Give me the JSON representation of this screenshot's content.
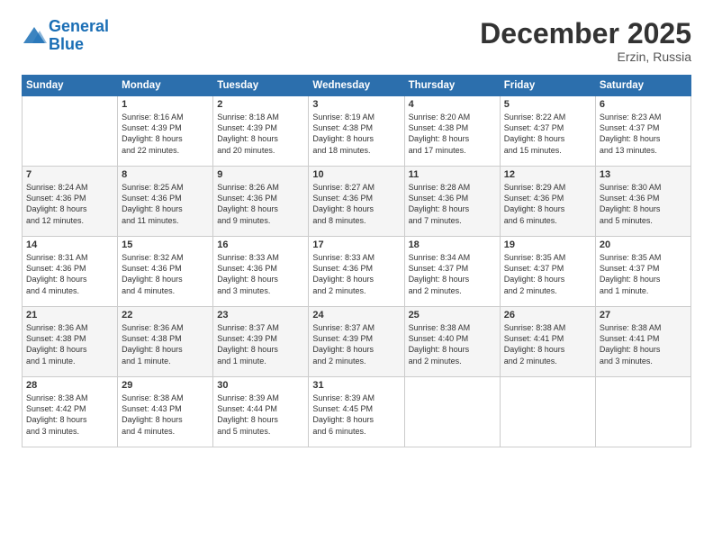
{
  "logo": {
    "line1": "General",
    "line2": "Blue"
  },
  "header": {
    "month": "December 2025",
    "location": "Erzin, Russia"
  },
  "weekdays": [
    "Sunday",
    "Monday",
    "Tuesday",
    "Wednesday",
    "Thursday",
    "Friday",
    "Saturday"
  ],
  "weeks": [
    [
      {
        "day": "",
        "info": ""
      },
      {
        "day": "1",
        "info": "Sunrise: 8:16 AM\nSunset: 4:39 PM\nDaylight: 8 hours\nand 22 minutes."
      },
      {
        "day": "2",
        "info": "Sunrise: 8:18 AM\nSunset: 4:39 PM\nDaylight: 8 hours\nand 20 minutes."
      },
      {
        "day": "3",
        "info": "Sunrise: 8:19 AM\nSunset: 4:38 PM\nDaylight: 8 hours\nand 18 minutes."
      },
      {
        "day": "4",
        "info": "Sunrise: 8:20 AM\nSunset: 4:38 PM\nDaylight: 8 hours\nand 17 minutes."
      },
      {
        "day": "5",
        "info": "Sunrise: 8:22 AM\nSunset: 4:37 PM\nDaylight: 8 hours\nand 15 minutes."
      },
      {
        "day": "6",
        "info": "Sunrise: 8:23 AM\nSunset: 4:37 PM\nDaylight: 8 hours\nand 13 minutes."
      }
    ],
    [
      {
        "day": "7",
        "info": "Sunrise: 8:24 AM\nSunset: 4:36 PM\nDaylight: 8 hours\nand 12 minutes."
      },
      {
        "day": "8",
        "info": "Sunrise: 8:25 AM\nSunset: 4:36 PM\nDaylight: 8 hours\nand 11 minutes."
      },
      {
        "day": "9",
        "info": "Sunrise: 8:26 AM\nSunset: 4:36 PM\nDaylight: 8 hours\nand 9 minutes."
      },
      {
        "day": "10",
        "info": "Sunrise: 8:27 AM\nSunset: 4:36 PM\nDaylight: 8 hours\nand 8 minutes."
      },
      {
        "day": "11",
        "info": "Sunrise: 8:28 AM\nSunset: 4:36 PM\nDaylight: 8 hours\nand 7 minutes."
      },
      {
        "day": "12",
        "info": "Sunrise: 8:29 AM\nSunset: 4:36 PM\nDaylight: 8 hours\nand 6 minutes."
      },
      {
        "day": "13",
        "info": "Sunrise: 8:30 AM\nSunset: 4:36 PM\nDaylight: 8 hours\nand 5 minutes."
      }
    ],
    [
      {
        "day": "14",
        "info": "Sunrise: 8:31 AM\nSunset: 4:36 PM\nDaylight: 8 hours\nand 4 minutes."
      },
      {
        "day": "15",
        "info": "Sunrise: 8:32 AM\nSunset: 4:36 PM\nDaylight: 8 hours\nand 4 minutes."
      },
      {
        "day": "16",
        "info": "Sunrise: 8:33 AM\nSunset: 4:36 PM\nDaylight: 8 hours\nand 3 minutes."
      },
      {
        "day": "17",
        "info": "Sunrise: 8:33 AM\nSunset: 4:36 PM\nDaylight: 8 hours\nand 2 minutes."
      },
      {
        "day": "18",
        "info": "Sunrise: 8:34 AM\nSunset: 4:37 PM\nDaylight: 8 hours\nand 2 minutes."
      },
      {
        "day": "19",
        "info": "Sunrise: 8:35 AM\nSunset: 4:37 PM\nDaylight: 8 hours\nand 2 minutes."
      },
      {
        "day": "20",
        "info": "Sunrise: 8:35 AM\nSunset: 4:37 PM\nDaylight: 8 hours\nand 1 minute."
      }
    ],
    [
      {
        "day": "21",
        "info": "Sunrise: 8:36 AM\nSunset: 4:38 PM\nDaylight: 8 hours\nand 1 minute."
      },
      {
        "day": "22",
        "info": "Sunrise: 8:36 AM\nSunset: 4:38 PM\nDaylight: 8 hours\nand 1 minute."
      },
      {
        "day": "23",
        "info": "Sunrise: 8:37 AM\nSunset: 4:39 PM\nDaylight: 8 hours\nand 1 minute."
      },
      {
        "day": "24",
        "info": "Sunrise: 8:37 AM\nSunset: 4:39 PM\nDaylight: 8 hours\nand 2 minutes."
      },
      {
        "day": "25",
        "info": "Sunrise: 8:38 AM\nSunset: 4:40 PM\nDaylight: 8 hours\nand 2 minutes."
      },
      {
        "day": "26",
        "info": "Sunrise: 8:38 AM\nSunset: 4:41 PM\nDaylight: 8 hours\nand 2 minutes."
      },
      {
        "day": "27",
        "info": "Sunrise: 8:38 AM\nSunset: 4:41 PM\nDaylight: 8 hours\nand 3 minutes."
      }
    ],
    [
      {
        "day": "28",
        "info": "Sunrise: 8:38 AM\nSunset: 4:42 PM\nDaylight: 8 hours\nand 3 minutes."
      },
      {
        "day": "29",
        "info": "Sunrise: 8:38 AM\nSunset: 4:43 PM\nDaylight: 8 hours\nand 4 minutes."
      },
      {
        "day": "30",
        "info": "Sunrise: 8:39 AM\nSunset: 4:44 PM\nDaylight: 8 hours\nand 5 minutes."
      },
      {
        "day": "31",
        "info": "Sunrise: 8:39 AM\nSunset: 4:45 PM\nDaylight: 8 hours\nand 6 minutes."
      },
      {
        "day": "",
        "info": ""
      },
      {
        "day": "",
        "info": ""
      },
      {
        "day": "",
        "info": ""
      }
    ]
  ]
}
